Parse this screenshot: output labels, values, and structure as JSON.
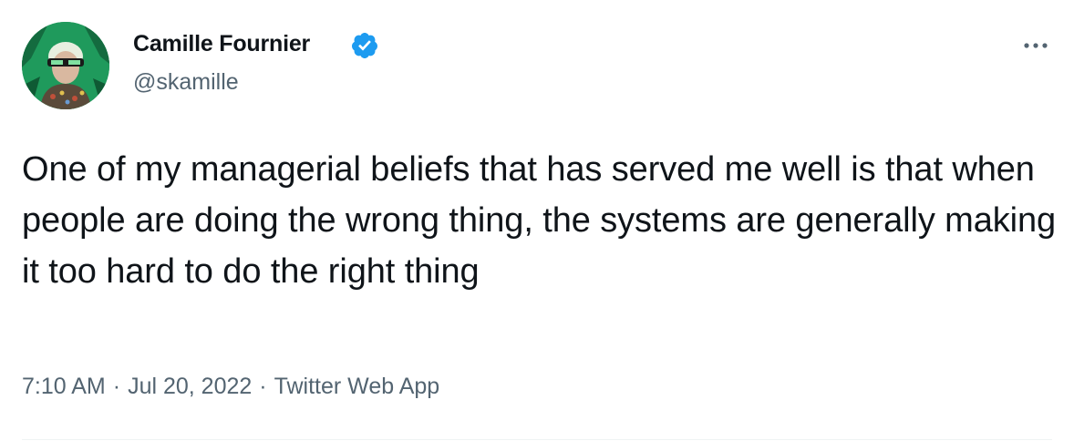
{
  "author": {
    "display_name": "Camille Fournier",
    "handle": "@skamille",
    "verified": true
  },
  "tweet": {
    "text": "One of my managerial beliefs that has served me well is that when people are doing the wrong thing, the systems are generally making it too hard to do the right thing",
    "time": "7:10 AM",
    "date": "Jul 20, 2022",
    "source": "Twitter Web App",
    "separator": "·"
  },
  "icons": {
    "verified": "verified-badge-icon",
    "more": "more-options-icon"
  },
  "colors": {
    "text_primary": "#0f1419",
    "text_secondary": "#536471",
    "verified_blue": "#1d9bf0",
    "divider": "#eff3f4"
  }
}
